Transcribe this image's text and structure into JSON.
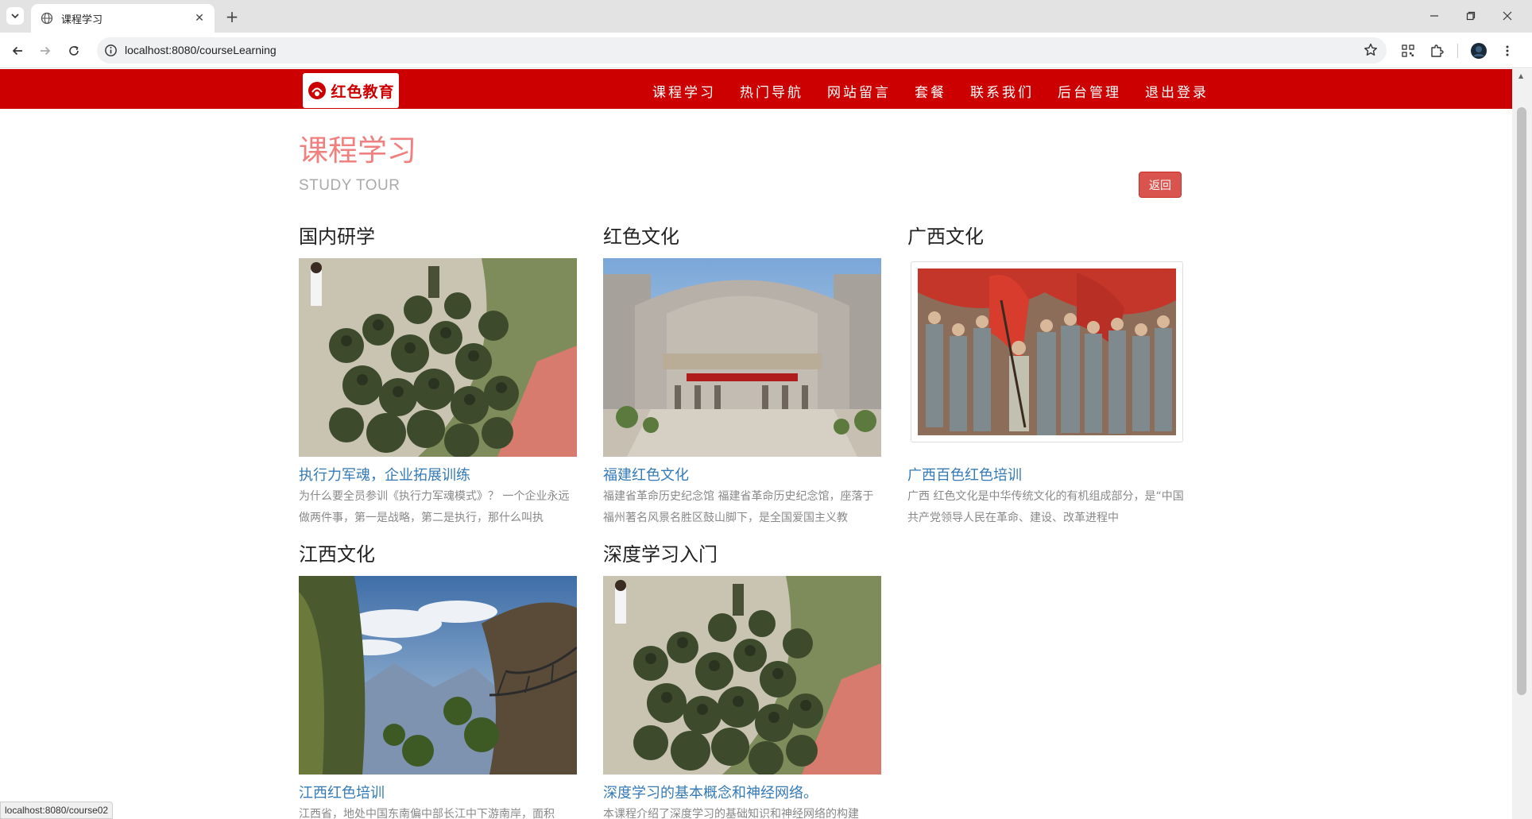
{
  "browser": {
    "tab_title": "课程学习",
    "url": "localhost:8080/courseLearning",
    "status_link": "localhost:8080/course02"
  },
  "navbar": {
    "logo_text": "红色教育",
    "items": [
      {
        "label": "课程学习"
      },
      {
        "label": "热门导航"
      },
      {
        "label": "网站留言"
      },
      {
        "label": "套餐"
      },
      {
        "label": "联系我们"
      },
      {
        "label": "后台管理"
      },
      {
        "label": "退出登录"
      }
    ]
  },
  "page": {
    "title": "课程学习",
    "subtitle": "STUDY TOUR",
    "back_label": "返回"
  },
  "courses": [
    {
      "category": "国内研学",
      "name": "执行力军魂，企业拓展训练",
      "description": "为什么要全员参训《执行力军魂模式》？ 一个企业永远做两件事，第一是战略，第二是执行，那什么叫执",
      "image": "soldiers-group-photo"
    },
    {
      "category": "红色文化",
      "name": "福建红色文化",
      "description": "福建省革命历史纪念馆 福建省革命历史纪念馆，座落于福州著名风景名胜区鼓山脚下，是全国爱国主义教",
      "image": "memorial-hall-photo"
    },
    {
      "category": "广西文化",
      "name": "广西百色红色培训",
      "description": "广西 红色文化是中华传统文化的有机组成部分，是“中国共产党领导人民在革命、建设、改革进程中",
      "image": "red-army-painting"
    },
    {
      "category": "江西文化",
      "name": "江西红色培训",
      "description": "江西省，地处中国东南偏中部长江中下游南岸，面积",
      "image": "mountain-walkway-photo"
    },
    {
      "category": "深度学习入门",
      "name": "深度学习的基本概念和神经网络。",
      "description": "本课程介绍了深度学习的基础知识和神经网络的构建",
      "image": "soldiers-group-photo"
    }
  ]
}
